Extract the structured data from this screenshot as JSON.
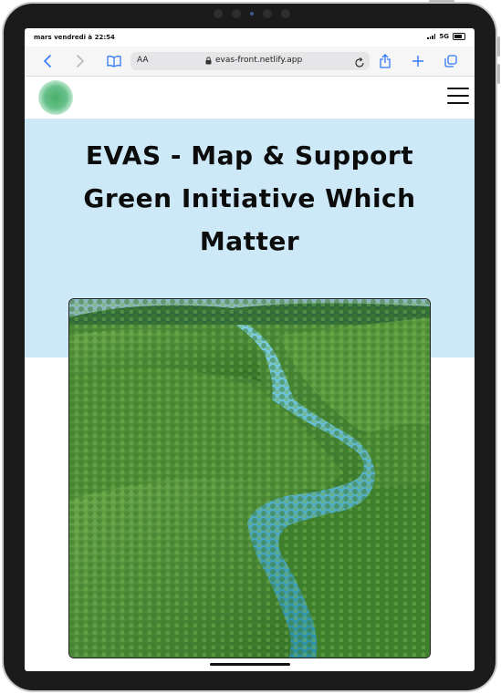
{
  "status_bar": {
    "time": "mars vendredi à 22:54",
    "network": "5G"
  },
  "browser": {
    "text_size_label": "AA",
    "url": "evas-front.netlify.app",
    "icons": [
      "back-icon",
      "forward-icon",
      "bookmarks-icon",
      "lock-icon",
      "reload-icon",
      "share-icon",
      "new-tab-icon",
      "tabs-icon"
    ]
  },
  "site": {
    "logo_alt": "EVAS logo",
    "hero_title": "EVAS - Map & Support Green Initiative Which Matter",
    "hero_image_alt": "Aerial view of a river winding through dense green forest"
  },
  "colors": {
    "hero_background": "#cde8f6",
    "accent_blue": "#3478f6",
    "logo_green": "#4caf6a"
  }
}
